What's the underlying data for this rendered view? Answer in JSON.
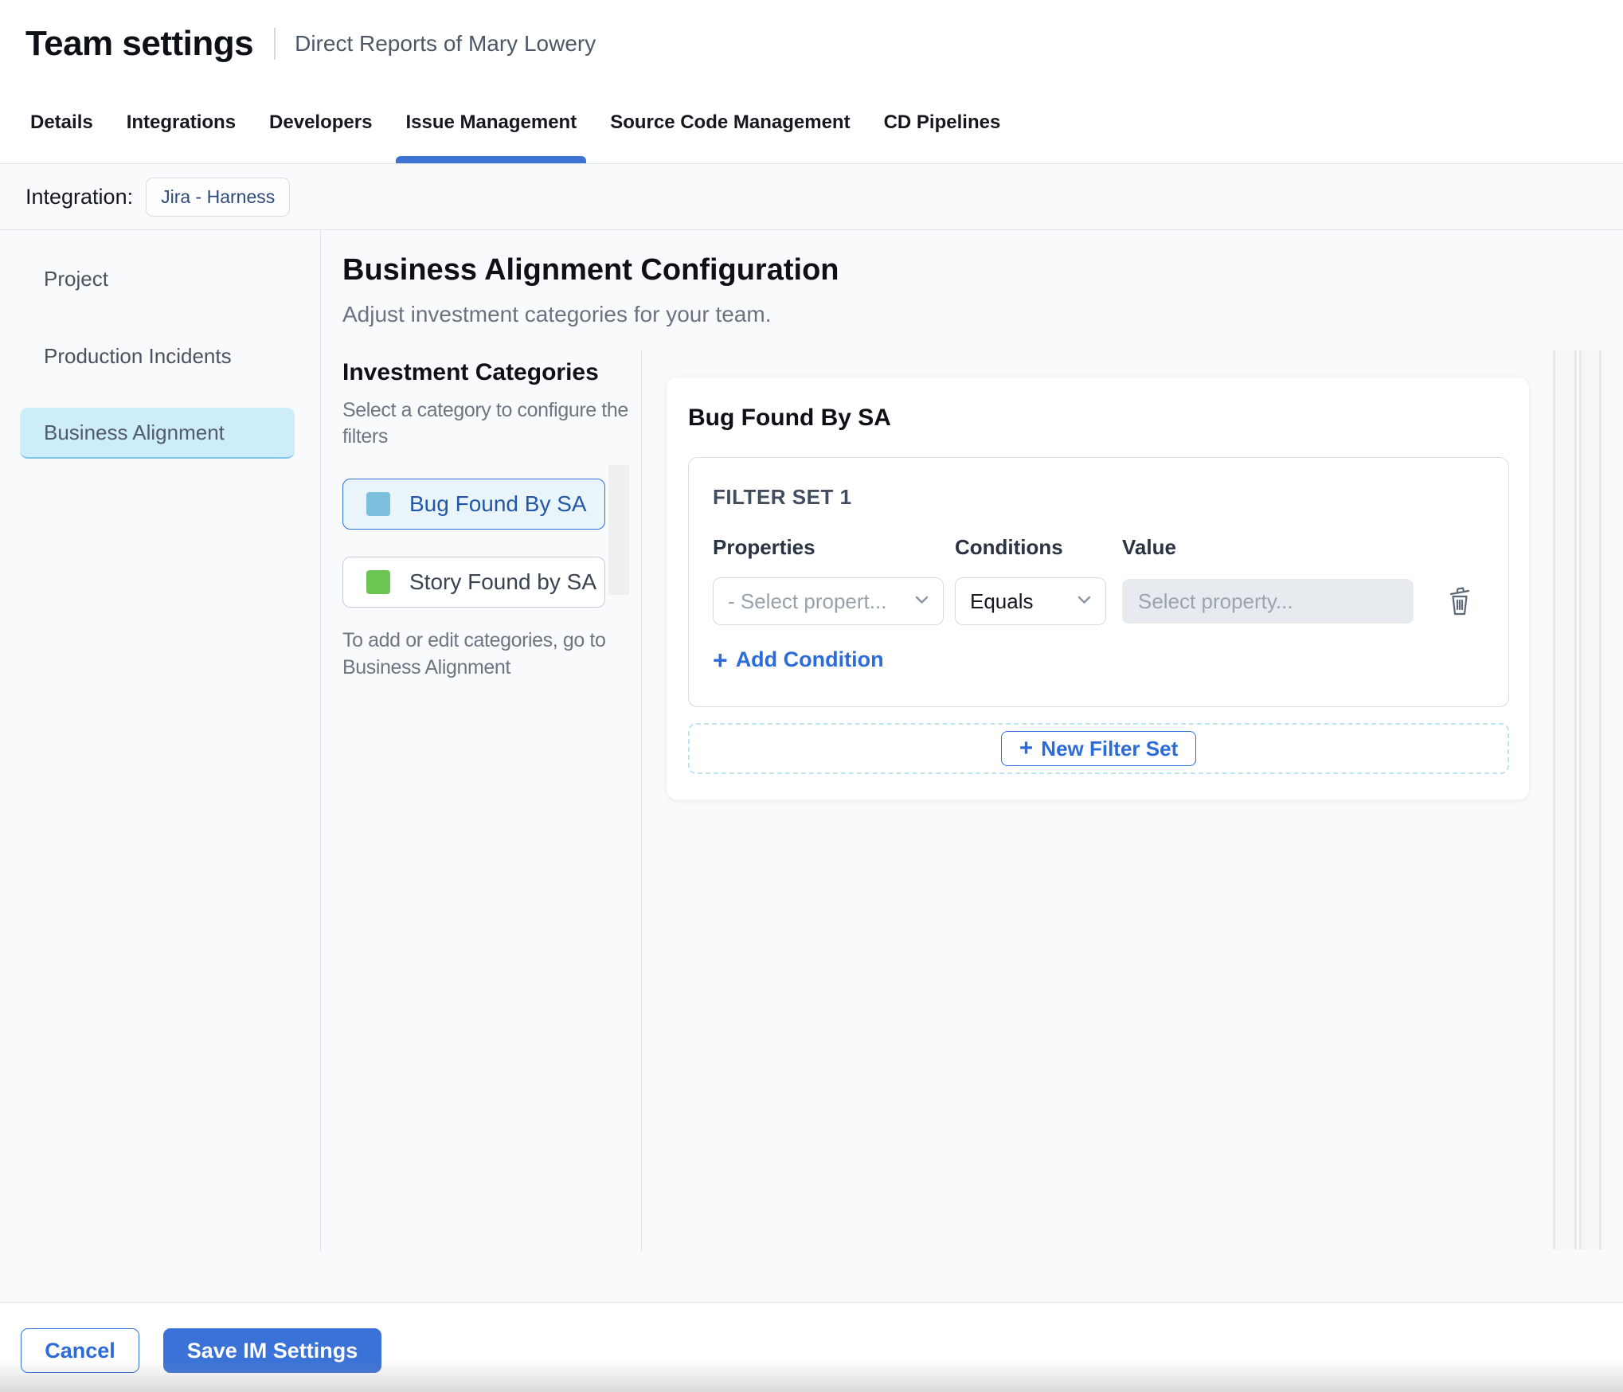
{
  "header": {
    "title": "Team settings",
    "subtitle": "Direct Reports of Mary Lowery",
    "tabs": [
      {
        "label": "Details",
        "active": false
      },
      {
        "label": "Integrations",
        "active": false
      },
      {
        "label": "Developers",
        "active": false
      },
      {
        "label": "Issue Management",
        "active": true
      },
      {
        "label": "Source Code Management",
        "active": false
      },
      {
        "label": "CD Pipelines",
        "active": false
      }
    ]
  },
  "integration": {
    "label": "Integration:",
    "chip": "Jira - Harness"
  },
  "sidebar": {
    "items": [
      {
        "label": "Project",
        "selected": false
      },
      {
        "label": "Production Incidents",
        "selected": false
      },
      {
        "label": "Business Alignment",
        "selected": true
      }
    ]
  },
  "main": {
    "heading": "Business Alignment Configuration",
    "subheading": "Adjust investment categories for your team.",
    "categories_panel": {
      "title": "Investment Categories",
      "hint": "Select a category to configure the filters",
      "items": [
        {
          "label": "Bug Found By SA",
          "color": "#7bbfdd",
          "selected": true
        },
        {
          "label": "Story Found by SA",
          "color": "#6cc453",
          "selected": false
        }
      ],
      "footnote": "To add or edit categories, go to Business Alignment"
    },
    "filter_panel": {
      "title": "Bug Found By SA",
      "filter_set_label": "FILTER SET 1",
      "columns": {
        "properties": "Properties",
        "conditions": "Conditions",
        "value": "Value"
      },
      "property_placeholder": "- Select propert...",
      "condition_value": "Equals",
      "value_placeholder": "Select property...",
      "add_condition_label": "Add Condition",
      "new_filter_set_label": "New Filter Set"
    }
  },
  "footer": {
    "cancel_label": "Cancel",
    "save_label": "Save IM Settings"
  },
  "icons": {
    "plus": "+",
    "chevron_down": "v-chevron",
    "trash": "trash-outline"
  },
  "colors": {
    "accent_blue": "#3470d6",
    "link_blue": "#2b6cd9",
    "active_tab_underline": "#3e73d4",
    "save_button_bg": "#3b72d8",
    "selected_sidebar_bg": "#cdedfa",
    "selected_category_bg": "#eaf5fb",
    "category_bug_swatch": "#7bbfdd",
    "category_story_swatch": "#6cc453",
    "content_bg": "#f8fafc",
    "value_input_bg": "#e7ebef"
  }
}
